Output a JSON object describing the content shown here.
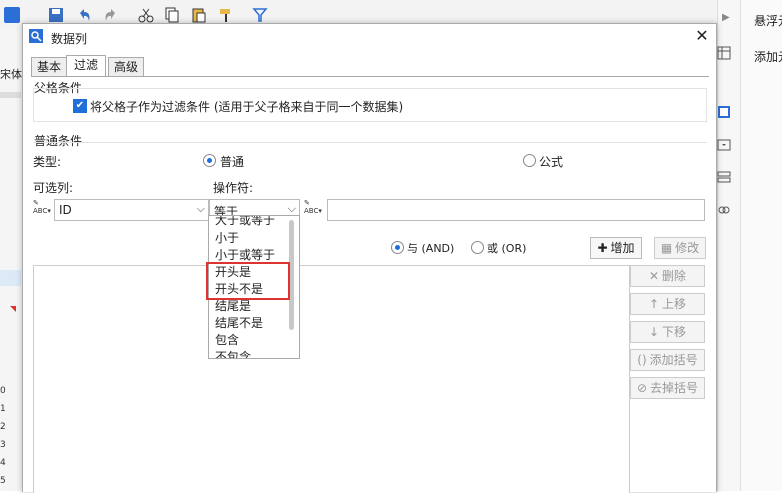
{
  "app": {
    "left_font_label": "宋体",
    "right_panel_title": "悬浮元",
    "right_panel_add": "添加元",
    "row_numbers": [
      "0",
      "1",
      "2",
      "3",
      "4",
      "5"
    ]
  },
  "dialog": {
    "title": "数据列",
    "tabs": [
      {
        "label": "基本",
        "active": false
      },
      {
        "label": "过滤",
        "active": true
      },
      {
        "label": "高级",
        "active": false
      }
    ],
    "parent_condition": {
      "section_label": "父格条件",
      "checkbox_label": "将父格子作为过滤条件 (适用于父子格来自于同一个数据集)",
      "checked": true
    },
    "normal_condition": {
      "section_label": "普通条件",
      "type_label": "类型:",
      "type_options": [
        {
          "label": "普通",
          "checked": true
        },
        {
          "label": "公式",
          "checked": false
        }
      ],
      "column_label": "可选列:",
      "operator_label": "操作符:",
      "column_value": "ID",
      "operator_value": "等于",
      "value_input": ""
    },
    "logic": {
      "and_label": "与 (AND)",
      "and_checked": true,
      "or_label": "或 (OR)",
      "or_checked": false
    },
    "buttons": {
      "add": "增加",
      "modify": "修改",
      "delete": "删除",
      "move_up": "上移",
      "move_down": "下移",
      "add_bracket": "添加括号",
      "remove_bracket": "去掉括号"
    },
    "operator_dropdown": {
      "items": [
        "大于或等于",
        "小于",
        "小于或等于",
        "开头是",
        "开头不是",
        "结尾是",
        "结尾不是",
        "包含",
        "不包含"
      ],
      "highlighted": [
        "开头是",
        "开头不是"
      ]
    }
  },
  "colors": {
    "accent": "#1e6fd9",
    "highlight_border": "#e0322f"
  }
}
